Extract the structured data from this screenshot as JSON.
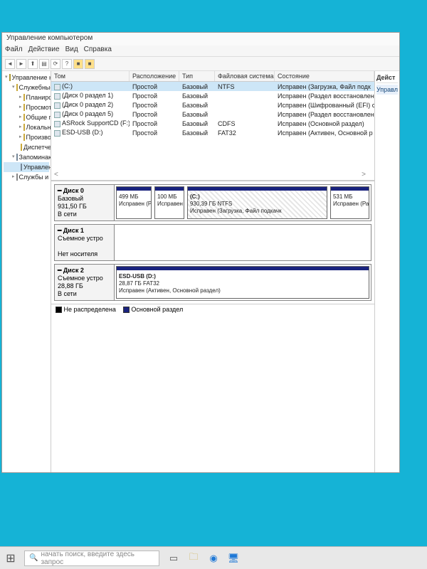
{
  "window": {
    "title": "Управление компьютером"
  },
  "menu": {
    "file": "Файл",
    "action": "Действие",
    "view": "Вид",
    "help": "Справка"
  },
  "tree": {
    "root": "Управление компьютером (л",
    "sys_tools": "Служебные программы",
    "scheduler": "Планировщик заданий",
    "eventvwr": "Просмотр событий",
    "shared": "Общие папки",
    "localusers": "Локальные пользова",
    "perf": "Производительность",
    "devmgr": "Диспетчер устройств",
    "storage": "Запоминающие устройст",
    "diskmgmt": "Управление дисками",
    "services": "Службы и приложения"
  },
  "right_panel": {
    "header": "Дейст",
    "item": "Управл"
  },
  "table": {
    "headers": {
      "vol": "Том",
      "layout": "Расположение",
      "type": "Тип",
      "fs": "Файловая система",
      "status": "Состояние"
    },
    "rows": [
      {
        "vol": "(C:)",
        "layout": "Простой",
        "type": "Базовый",
        "fs": "NTFS",
        "status": "Исправен (Загрузка, Файл подк"
      },
      {
        "vol": "(Диск 0 раздел 1)",
        "layout": "Простой",
        "type": "Базовый",
        "fs": "",
        "status": "Исправен (Раздел восстановлен"
      },
      {
        "vol": "(Диск 0 раздел 2)",
        "layout": "Простой",
        "type": "Базовый",
        "fs": "",
        "status": "Исправен (Шифрованный (EFI) с"
      },
      {
        "vol": "(Диск 0 раздел 5)",
        "layout": "Простой",
        "type": "Базовый",
        "fs": "",
        "status": "Исправен (Раздел восстановлен"
      },
      {
        "vol": "ASRock SupportCD (F:)",
        "layout": "Простой",
        "type": "Базовый",
        "fs": "CDFS",
        "status": "Исправен (Основной раздел)"
      },
      {
        "vol": "ESD-USB (D:)",
        "layout": "Простой",
        "type": "Базовый",
        "fs": "FAT32",
        "status": "Исправен (Активен, Основной р"
      }
    ]
  },
  "disks": {
    "d0": {
      "name": "Диск 0",
      "type": "Базовый",
      "size": "931,50 ГБ",
      "status": "В сети",
      "p1": {
        "size": "499 МБ",
        "status": "Исправен (Раз"
      },
      "p2": {
        "size": "100 МБ",
        "status": "Исправен"
      },
      "p3": {
        "label": "(C:)",
        "size": "930,39 ГБ NTFS",
        "status": "Исправен (Загрузка, Файл подкачк"
      },
      "p4": {
        "size": "531 МБ",
        "status": "Исправен (Раз,"
      }
    },
    "d1": {
      "name": "Диск 1",
      "type": "Съемное устро",
      "status": "Нет носителя"
    },
    "d2": {
      "name": "Диск 2",
      "type": "Съемное устро",
      "size": "28,88 ГБ",
      "status": "В сети",
      "p1": {
        "label": "ESD-USB (D:)",
        "size": "28,87 ГБ FAT32",
        "status": "Исправен (Активен, Основной раздел)"
      }
    }
  },
  "legend": {
    "unalloc": "Не распределена",
    "primary": "Основной раздел"
  },
  "taskbar": {
    "search_placeholder": "начать поиск, введите здесь запрос"
  }
}
